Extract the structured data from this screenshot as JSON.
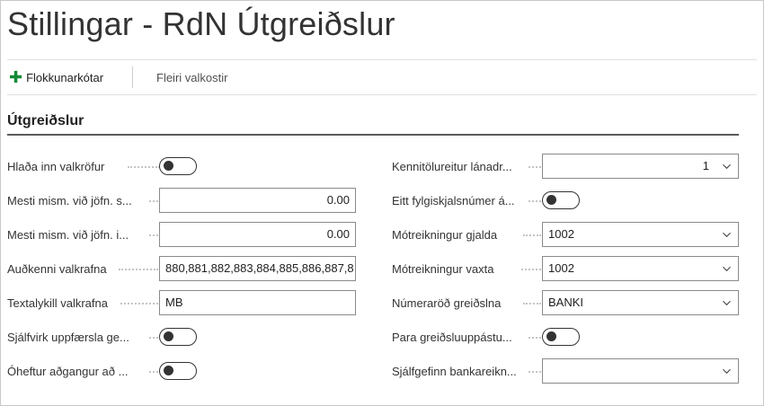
{
  "page": {
    "title": "Stillingar - RdN Útgreiðslur"
  },
  "actions": {
    "add_label": "Flokkunarkótar",
    "more_label": "Fleiri valkostir"
  },
  "section": {
    "title": "Útgreiðslur"
  },
  "left_fields": [
    {
      "label": "Hlaða inn valkröfur",
      "type": "toggle",
      "checked": false
    },
    {
      "label": "Mesti mism. við jöfn. s...",
      "type": "number",
      "value": "0.00"
    },
    {
      "label": "Mesti mism. við jöfn. i...",
      "type": "number",
      "value": "0.00"
    },
    {
      "label": "Auðkenni valkrafna",
      "type": "text",
      "value": "880,881,882,883,884,885,886,887,8"
    },
    {
      "label": "Textalykill valkrafna",
      "type": "text",
      "value": "MB"
    },
    {
      "label": "Sjálfvirk uppfærsla ge...",
      "type": "toggle",
      "checked": false
    },
    {
      "label": "Óheftur aðgangur að ...",
      "type": "toggle",
      "checked": false
    }
  ],
  "right_fields": [
    {
      "label": "Kennitölureitur lánadr...",
      "type": "select",
      "value": "1"
    },
    {
      "label": "Eitt fylgiskjalsnúmer á...",
      "type": "toggle",
      "checked": false
    },
    {
      "label": "Mótreikningur gjalda",
      "type": "select",
      "value": "1002"
    },
    {
      "label": "Mótreikningur vaxta",
      "type": "select",
      "value": "1002"
    },
    {
      "label": "Númeraröð greiðslna",
      "type": "select",
      "value": "BANKI"
    },
    {
      "label": "Para greiðsluuppástu...",
      "type": "toggle",
      "checked": false
    },
    {
      "label": "Sjálfgefinn bankareikn...",
      "type": "select",
      "value": ""
    }
  ],
  "icons": {
    "add": "plus-icon",
    "dropdown": "chevron-down-icon"
  },
  "colors": {
    "accent_green": "#138a36",
    "toggle_off": "#333333"
  }
}
